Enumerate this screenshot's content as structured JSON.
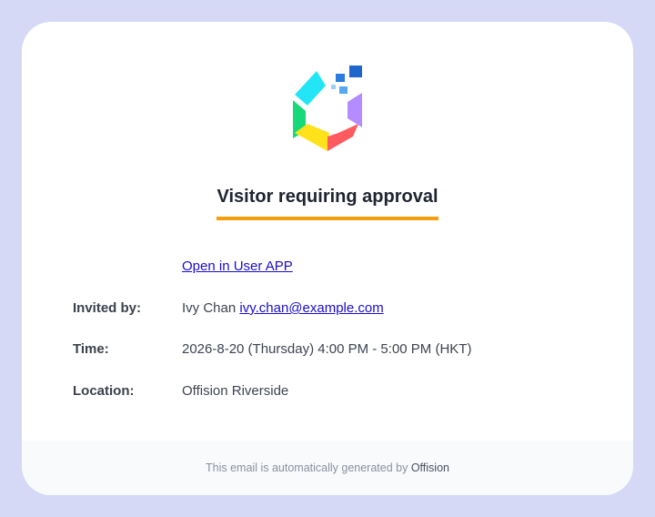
{
  "header": {
    "title": "Visitor requiring approval"
  },
  "actions": {
    "open_link_label": "Open in User APP"
  },
  "details": {
    "invited_by": {
      "label": "Invited by:",
      "name": "Ivy Chan",
      "email": "ivy.chan@example.com"
    },
    "time": {
      "label": "Time:",
      "value": "2026-8-20 (Thursday) 4:00 PM - 5:00 PM (HKT)"
    },
    "location": {
      "label": "Location:",
      "value": "Offision Riverside"
    }
  },
  "footer": {
    "text": "This email is automatically generated by",
    "brand": "Offision"
  },
  "colors": {
    "page_background": "#d5d9f5",
    "title_underline": "#f59e0b",
    "link": "#1a0dcc"
  },
  "icons": {
    "logo": "offision-hexagon-logo"
  }
}
